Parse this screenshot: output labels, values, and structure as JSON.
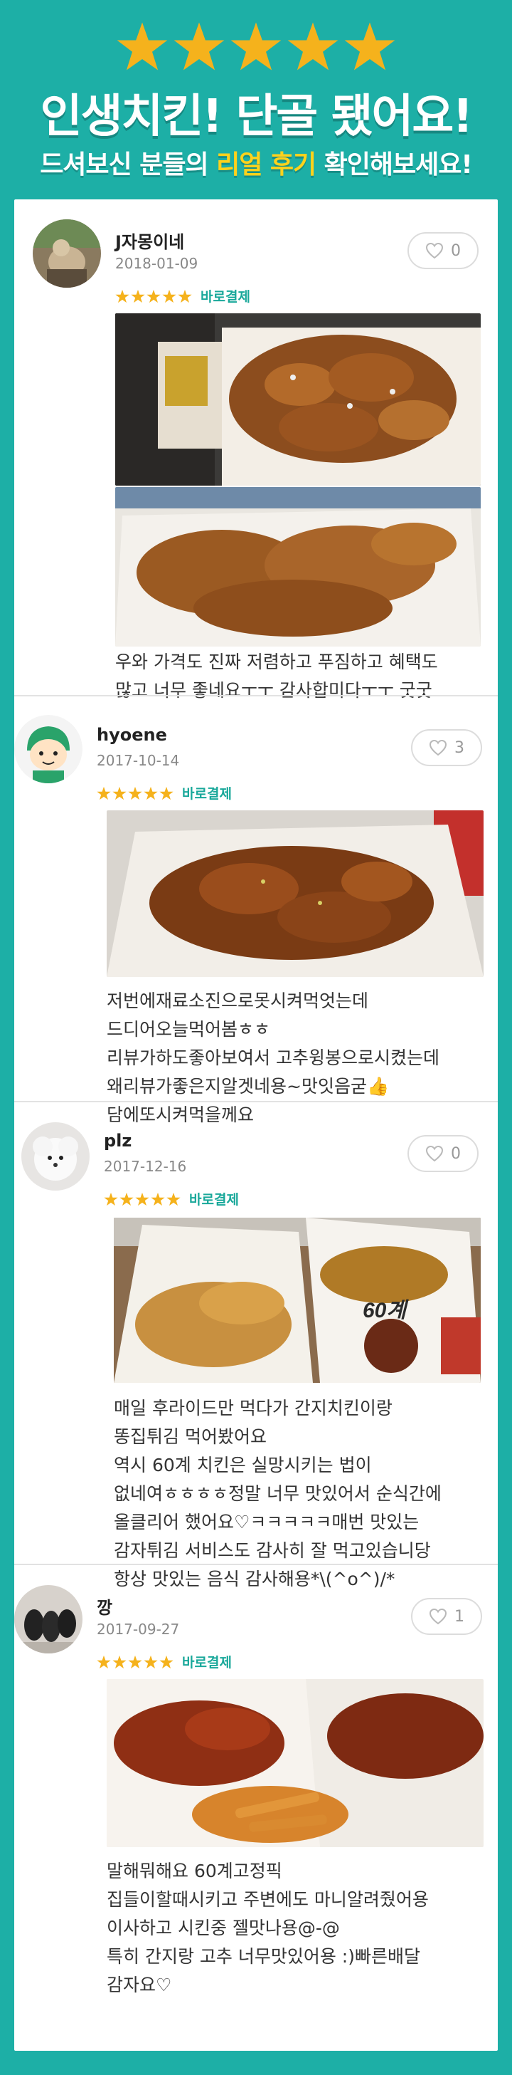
{
  "header": {
    "stars_count": 5,
    "title": "인생치킨! 단골 됐어요!",
    "subtitle_prefix": "드셔보신 분들의 ",
    "subtitle_highlight": "리얼 후기",
    "subtitle_suffix": " 확인해보세요!"
  },
  "colors": {
    "background": "#1dafa6",
    "star": "#f5b21c",
    "highlight": "#ffd21c",
    "badge": "#19a89a"
  },
  "reviews": [
    {
      "username": "J자몽이네",
      "date": "2018-01-09",
      "likes": "0",
      "badge": "바로결제",
      "text": "우와 가격도 진짜 저렴하고 푸짐하고 혜택도\n많고 너무 좋네요ㅜㅜ 감사합미다ㅜㅜ 굿굿"
    },
    {
      "username": "hyoene",
      "date": "2017-10-14",
      "likes": "3",
      "badge": "바로결제",
      "text": "저번에재료소진으로못시켜먹엇는데\n드디어오늘먹어봄ㅎㅎ\n리뷰가하도좋아보여서 고추윙봉으로시켰는데\n왜리뷰가좋은지알겟네용~맛잇음굳👍\n담에또시켜먹을께요"
    },
    {
      "username": "plz",
      "date": "2017-12-16",
      "likes": "0",
      "badge": "바로결제",
      "text": "매일 후라이드만 먹다가 간지치킨이랑\n똥집튀김 먹어봤어요\n역시 60계 치킨은 실망시키는 법이\n없네여ㅎㅎㅎㅎ정말 너무 맛있어서 순식간에\n올클리어 했어요♡ㅋㅋㅋㅋㅋ매번 맛있는\n감자튀김 서비스도 감사히 잘 먹고있습니당\n항상 맛있는 음식 감사해용*\\(^o^)/*"
    },
    {
      "username": "깡",
      "date": "2017-09-27",
      "likes": "1",
      "badge": "바로결제",
      "text": "말해뭐해요 60계고정픽\n집들이할때시키고 주변에도 마니알려줬어용\n이사하고 시킨중 젤맛나용@-@\n특히 간지랑 고추 너무맛있어용 :)빠른배달\n감자요♡"
    }
  ]
}
